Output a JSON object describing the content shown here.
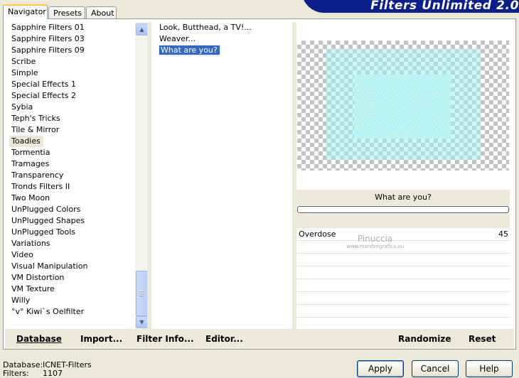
{
  "tabs": [
    "Navigator",
    "Presets",
    "About"
  ],
  "banner_title": "Filters Unlimited 2.0",
  "categories": [
    "Sapphire Filters 01",
    "Sapphire Filters 03",
    "Sapphire Filters 09",
    "Scribe",
    "Simple",
    "Special Effects 1",
    "Special Effects 2",
    "Sybia",
    "Teph's Tricks",
    "Tile & Mirror",
    "Toadies",
    "Tormentia",
    "Tramages",
    "Transparency",
    "Tronds Filters II",
    "Two Moon",
    "UnPlugged Colors",
    "UnPlugged Shapes",
    "UnPlugged Tools",
    "Variations",
    "Video",
    "Visual Manipulation",
    "VM Distortion",
    "VM Texture",
    "Willy",
    "°v° Kiwi`s Oelfilter"
  ],
  "filters": [
    "Look, Butthead, a TV!...",
    "Weaver...",
    "What are you?"
  ],
  "preview": {
    "filter_name": "What are you?",
    "progress": 0
  },
  "parameters": [
    {
      "name": "Overdose",
      "value": "45"
    }
  ],
  "watermark": {
    "line1": "Pinuccia",
    "line2": "www.mardiregrafica.eu"
  },
  "toolbar": {
    "database": "Database",
    "import": "Import...",
    "filter_info": "Filter Info...",
    "editor": "Editor...",
    "randomize": "Randomize",
    "reset": "Reset"
  },
  "status": {
    "database_label": "Database:",
    "database_value": "ICNET-Filters",
    "filters_label": "Filters:",
    "filters_value": "1107"
  },
  "dialog_buttons": {
    "apply": "Apply",
    "cancel": "Cancel",
    "help": "Help"
  }
}
